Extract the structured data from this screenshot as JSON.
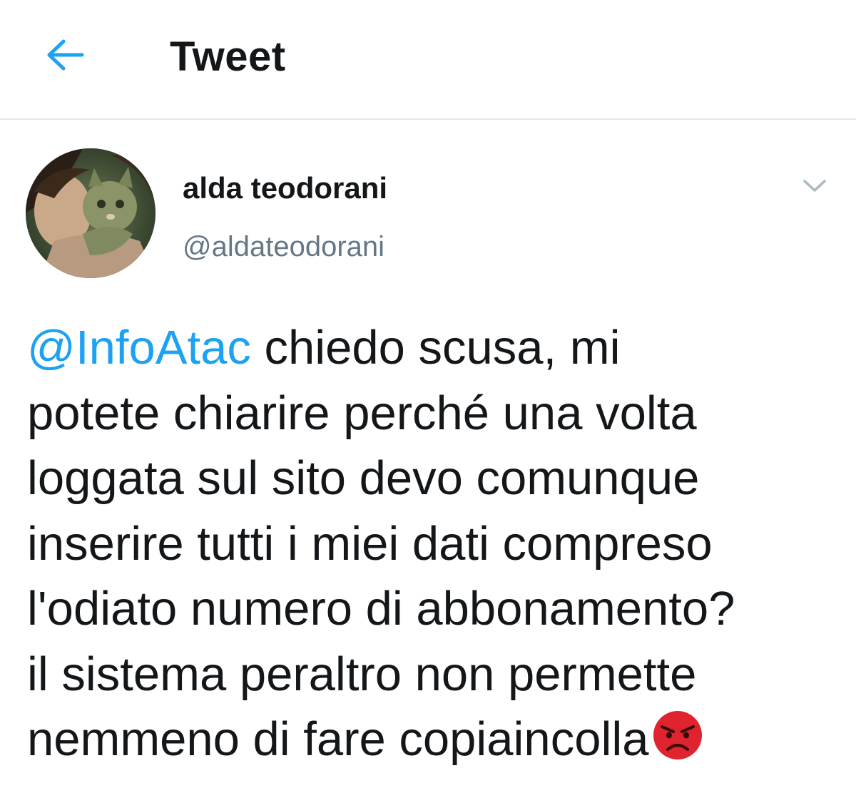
{
  "header": {
    "title": "Tweet",
    "back_icon": "arrow-left-icon",
    "accent_color": "#1da1f2"
  },
  "tweet": {
    "author": {
      "display_name": "alda teodorani",
      "handle": "@aldateodorani",
      "avatar_icon": "user-avatar-photo"
    },
    "menu_icon": "chevron-down-icon",
    "mention": "@InfoAtac",
    "text_lines": [
      " chiedo scusa, mi",
      "potete chiarire perché una volta",
      "loggata sul sito devo comunque",
      "inserire tutti i miei dati compreso",
      "l'odiato numero di abbonamento?",
      "il sistema peraltro non permette",
      "nemmeno di fare copiaincolla"
    ],
    "emoji": "angry-face-emoji",
    "emoji_color": "#e0242f"
  }
}
